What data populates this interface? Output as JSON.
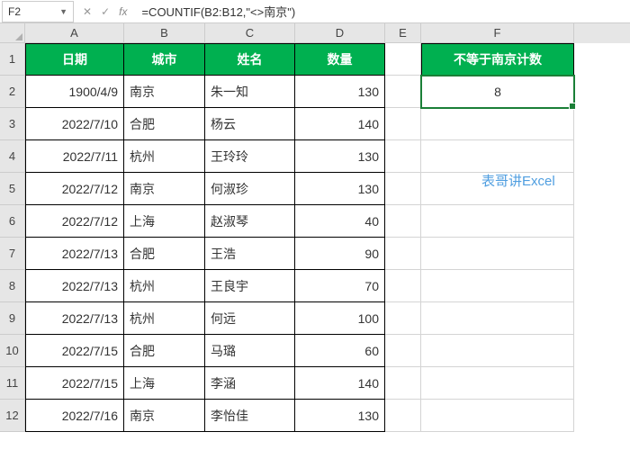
{
  "name_box": "F2",
  "formula": "=COUNTIF(B2:B12,\"<>南京\")",
  "columns": [
    "A",
    "B",
    "C",
    "D",
    "E",
    "F"
  ],
  "headers": {
    "A": "日期",
    "B": "城市",
    "C": "姓名",
    "D": "数量",
    "F": "不等于南京计数"
  },
  "result_cell": "8",
  "rows": [
    {
      "n": "1"
    },
    {
      "n": "2",
      "a": "1900/4/9",
      "b": "南京",
      "c": "朱一知",
      "d": "130"
    },
    {
      "n": "3",
      "a": "2022/7/10",
      "b": "合肥",
      "c": "杨云",
      "d": "140"
    },
    {
      "n": "4",
      "a": "2022/7/11",
      "b": "杭州",
      "c": "王玲玲",
      "d": "130"
    },
    {
      "n": "5",
      "a": "2022/7/12",
      "b": "南京",
      "c": "何淑珍",
      "d": "130"
    },
    {
      "n": "6",
      "a": "2022/7/12",
      "b": "上海",
      "c": "赵淑琴",
      "d": "40"
    },
    {
      "n": "7",
      "a": "2022/7/13",
      "b": "合肥",
      "c": "王浩",
      "d": "90"
    },
    {
      "n": "8",
      "a": "2022/7/13",
      "b": "杭州",
      "c": "王良宇",
      "d": "70"
    },
    {
      "n": "9",
      "a": "2022/7/13",
      "b": "杭州",
      "c": "何远",
      "d": "100"
    },
    {
      "n": "10",
      "a": "2022/7/15",
      "b": "合肥",
      "c": "马璐",
      "d": "60"
    },
    {
      "n": "11",
      "a": "2022/7/15",
      "b": "上海",
      "c": "李涵",
      "d": "140"
    },
    {
      "n": "12",
      "a": "2022/7/16",
      "b": "南京",
      "c": "李怡佳",
      "d": "130"
    }
  ],
  "watermark": "表哥讲Excel",
  "chart_data": {
    "type": "table",
    "title": "不等于南京计数",
    "columns": [
      "日期",
      "城市",
      "姓名",
      "数量"
    ],
    "data": [
      [
        "1900/4/9",
        "南京",
        "朱一知",
        130
      ],
      [
        "2022/7/10",
        "合肥",
        "杨云",
        140
      ],
      [
        "2022/7/11",
        "杭州",
        "王玲玲",
        130
      ],
      [
        "2022/7/12",
        "南京",
        "何淑珍",
        130
      ],
      [
        "2022/7/12",
        "上海",
        "赵淑琴",
        40
      ],
      [
        "2022/7/13",
        "合肥",
        "王浩",
        90
      ],
      [
        "2022/7/13",
        "杭州",
        "王良宇",
        70
      ],
      [
        "2022/7/13",
        "杭州",
        "何远",
        100
      ],
      [
        "2022/7/15",
        "合肥",
        "马璐",
        60
      ],
      [
        "2022/7/15",
        "上海",
        "李涵",
        140
      ],
      [
        "2022/7/16",
        "南京",
        "李怡佳",
        130
      ]
    ],
    "computed": {
      "label": "不等于南京计数",
      "formula": "=COUNTIF(B2:B12,\"<>南京\")",
      "value": 8
    }
  }
}
